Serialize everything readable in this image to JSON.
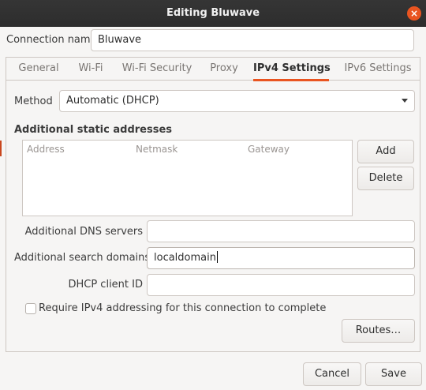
{
  "window": {
    "title": "Editing Bluwave",
    "close_glyph": "×"
  },
  "connection_name": {
    "label": "Connection name",
    "value": "Bluwave"
  },
  "tabs": [
    {
      "label": "General",
      "active": false
    },
    {
      "label": "Wi-Fi",
      "active": false
    },
    {
      "label": "Wi-Fi Security",
      "active": false
    },
    {
      "label": "Proxy",
      "active": false
    },
    {
      "label": "IPv4 Settings",
      "active": true
    },
    {
      "label": "IPv6 Settings",
      "active": false
    }
  ],
  "ipv4": {
    "method_label": "Method",
    "method_value": "Automatic (DHCP)",
    "static_title": "Additional static addresses",
    "table_columns": [
      "Address",
      "Netmask",
      "Gateway"
    ],
    "add_label": "Add",
    "delete_label": "Delete",
    "dns_label": "Additional DNS servers",
    "dns_value": "",
    "search_label": "Additional search domains",
    "search_value": "localdomain",
    "dhcp_label": "DHCP client ID",
    "dhcp_value": "",
    "require_label": "Require IPv4 addressing for this connection to complete",
    "require_checked": false,
    "routes_label": "Routes…"
  },
  "footer": {
    "cancel_label": "Cancel",
    "save_label": "Save"
  },
  "colors": {
    "accent": "#e95420",
    "titlebar": "#2d2d2d",
    "background": "#f6f5f4"
  }
}
